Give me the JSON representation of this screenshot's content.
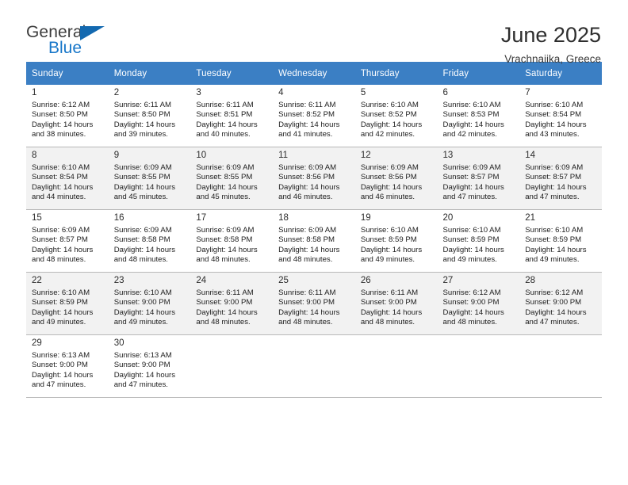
{
  "brand": {
    "word1": "General",
    "word2": "Blue",
    "triangle_icon": "triangle-icon",
    "accent_color": "#1369b0",
    "text_color": "#3c3c3c"
  },
  "header": {
    "title": "June 2025",
    "location": "Vrachnaiika, Greece"
  },
  "theme": {
    "header_row_bg": "#3b7fc4",
    "header_row_text": "#ffffff",
    "shaded_row_bg": "#f2f2f2",
    "cell_border": "#b8b8b8"
  },
  "calendar": {
    "weekday_headers": [
      "Sunday",
      "Monday",
      "Tuesday",
      "Wednesday",
      "Thursday",
      "Friday",
      "Saturday"
    ],
    "labels": {
      "sunrise": "Sunrise:",
      "sunset": "Sunset:",
      "daylight": "Daylight:"
    },
    "weeks": [
      {
        "shaded": false,
        "days": [
          {
            "day": "1",
            "sunrise": "Sunrise: 6:12 AM",
            "sunset": "Sunset: 8:50 PM",
            "daylight_line1": "Daylight: 14 hours",
            "daylight_line2": "and 38 minutes."
          },
          {
            "day": "2",
            "sunrise": "Sunrise: 6:11 AM",
            "sunset": "Sunset: 8:50 PM",
            "daylight_line1": "Daylight: 14 hours",
            "daylight_line2": "and 39 minutes."
          },
          {
            "day": "3",
            "sunrise": "Sunrise: 6:11 AM",
            "sunset": "Sunset: 8:51 PM",
            "daylight_line1": "Daylight: 14 hours",
            "daylight_line2": "and 40 minutes."
          },
          {
            "day": "4",
            "sunrise": "Sunrise: 6:11 AM",
            "sunset": "Sunset: 8:52 PM",
            "daylight_line1": "Daylight: 14 hours",
            "daylight_line2": "and 41 minutes."
          },
          {
            "day": "5",
            "sunrise": "Sunrise: 6:10 AM",
            "sunset": "Sunset: 8:52 PM",
            "daylight_line1": "Daylight: 14 hours",
            "daylight_line2": "and 42 minutes."
          },
          {
            "day": "6",
            "sunrise": "Sunrise: 6:10 AM",
            "sunset": "Sunset: 8:53 PM",
            "daylight_line1": "Daylight: 14 hours",
            "daylight_line2": "and 42 minutes."
          },
          {
            "day": "7",
            "sunrise": "Sunrise: 6:10 AM",
            "sunset": "Sunset: 8:54 PM",
            "daylight_line1": "Daylight: 14 hours",
            "daylight_line2": "and 43 minutes."
          }
        ]
      },
      {
        "shaded": true,
        "days": [
          {
            "day": "8",
            "sunrise": "Sunrise: 6:10 AM",
            "sunset": "Sunset: 8:54 PM",
            "daylight_line1": "Daylight: 14 hours",
            "daylight_line2": "and 44 minutes."
          },
          {
            "day": "9",
            "sunrise": "Sunrise: 6:09 AM",
            "sunset": "Sunset: 8:55 PM",
            "daylight_line1": "Daylight: 14 hours",
            "daylight_line2": "and 45 minutes."
          },
          {
            "day": "10",
            "sunrise": "Sunrise: 6:09 AM",
            "sunset": "Sunset: 8:55 PM",
            "daylight_line1": "Daylight: 14 hours",
            "daylight_line2": "and 45 minutes."
          },
          {
            "day": "11",
            "sunrise": "Sunrise: 6:09 AM",
            "sunset": "Sunset: 8:56 PM",
            "daylight_line1": "Daylight: 14 hours",
            "daylight_line2": "and 46 minutes."
          },
          {
            "day": "12",
            "sunrise": "Sunrise: 6:09 AM",
            "sunset": "Sunset: 8:56 PM",
            "daylight_line1": "Daylight: 14 hours",
            "daylight_line2": "and 46 minutes."
          },
          {
            "day": "13",
            "sunrise": "Sunrise: 6:09 AM",
            "sunset": "Sunset: 8:57 PM",
            "daylight_line1": "Daylight: 14 hours",
            "daylight_line2": "and 47 minutes."
          },
          {
            "day": "14",
            "sunrise": "Sunrise: 6:09 AM",
            "sunset": "Sunset: 8:57 PM",
            "daylight_line1": "Daylight: 14 hours",
            "daylight_line2": "and 47 minutes."
          }
        ]
      },
      {
        "shaded": false,
        "days": [
          {
            "day": "15",
            "sunrise": "Sunrise: 6:09 AM",
            "sunset": "Sunset: 8:57 PM",
            "daylight_line1": "Daylight: 14 hours",
            "daylight_line2": "and 48 minutes."
          },
          {
            "day": "16",
            "sunrise": "Sunrise: 6:09 AM",
            "sunset": "Sunset: 8:58 PM",
            "daylight_line1": "Daylight: 14 hours",
            "daylight_line2": "and 48 minutes."
          },
          {
            "day": "17",
            "sunrise": "Sunrise: 6:09 AM",
            "sunset": "Sunset: 8:58 PM",
            "daylight_line1": "Daylight: 14 hours",
            "daylight_line2": "and 48 minutes."
          },
          {
            "day": "18",
            "sunrise": "Sunrise: 6:09 AM",
            "sunset": "Sunset: 8:58 PM",
            "daylight_line1": "Daylight: 14 hours",
            "daylight_line2": "and 48 minutes."
          },
          {
            "day": "19",
            "sunrise": "Sunrise: 6:10 AM",
            "sunset": "Sunset: 8:59 PM",
            "daylight_line1": "Daylight: 14 hours",
            "daylight_line2": "and 49 minutes."
          },
          {
            "day": "20",
            "sunrise": "Sunrise: 6:10 AM",
            "sunset": "Sunset: 8:59 PM",
            "daylight_line1": "Daylight: 14 hours",
            "daylight_line2": "and 49 minutes."
          },
          {
            "day": "21",
            "sunrise": "Sunrise: 6:10 AM",
            "sunset": "Sunset: 8:59 PM",
            "daylight_line1": "Daylight: 14 hours",
            "daylight_line2": "and 49 minutes."
          }
        ]
      },
      {
        "shaded": true,
        "days": [
          {
            "day": "22",
            "sunrise": "Sunrise: 6:10 AM",
            "sunset": "Sunset: 8:59 PM",
            "daylight_line1": "Daylight: 14 hours",
            "daylight_line2": "and 49 minutes."
          },
          {
            "day": "23",
            "sunrise": "Sunrise: 6:10 AM",
            "sunset": "Sunset: 9:00 PM",
            "daylight_line1": "Daylight: 14 hours",
            "daylight_line2": "and 49 minutes."
          },
          {
            "day": "24",
            "sunrise": "Sunrise: 6:11 AM",
            "sunset": "Sunset: 9:00 PM",
            "daylight_line1": "Daylight: 14 hours",
            "daylight_line2": "and 48 minutes."
          },
          {
            "day": "25",
            "sunrise": "Sunrise: 6:11 AM",
            "sunset": "Sunset: 9:00 PM",
            "daylight_line1": "Daylight: 14 hours",
            "daylight_line2": "and 48 minutes."
          },
          {
            "day": "26",
            "sunrise": "Sunrise: 6:11 AM",
            "sunset": "Sunset: 9:00 PM",
            "daylight_line1": "Daylight: 14 hours",
            "daylight_line2": "and 48 minutes."
          },
          {
            "day": "27",
            "sunrise": "Sunrise: 6:12 AM",
            "sunset": "Sunset: 9:00 PM",
            "daylight_line1": "Daylight: 14 hours",
            "daylight_line2": "and 48 minutes."
          },
          {
            "day": "28",
            "sunrise": "Sunrise: 6:12 AM",
            "sunset": "Sunset: 9:00 PM",
            "daylight_line1": "Daylight: 14 hours",
            "daylight_line2": "and 47 minutes."
          }
        ]
      },
      {
        "shaded": false,
        "days": [
          {
            "day": "29",
            "sunrise": "Sunrise: 6:13 AM",
            "sunset": "Sunset: 9:00 PM",
            "daylight_line1": "Daylight: 14 hours",
            "daylight_line2": "and 47 minutes."
          },
          {
            "day": "30",
            "sunrise": "Sunrise: 6:13 AM",
            "sunset": "Sunset: 9:00 PM",
            "daylight_line1": "Daylight: 14 hours",
            "daylight_line2": "and 47 minutes."
          },
          {
            "day": "",
            "sunrise": "",
            "sunset": "",
            "daylight_line1": "",
            "daylight_line2": ""
          },
          {
            "day": "",
            "sunrise": "",
            "sunset": "",
            "daylight_line1": "",
            "daylight_line2": ""
          },
          {
            "day": "",
            "sunrise": "",
            "sunset": "",
            "daylight_line1": "",
            "daylight_line2": ""
          },
          {
            "day": "",
            "sunrise": "",
            "sunset": "",
            "daylight_line1": "",
            "daylight_line2": ""
          },
          {
            "day": "",
            "sunrise": "",
            "sunset": "",
            "daylight_line1": "",
            "daylight_line2": ""
          }
        ]
      }
    ]
  }
}
